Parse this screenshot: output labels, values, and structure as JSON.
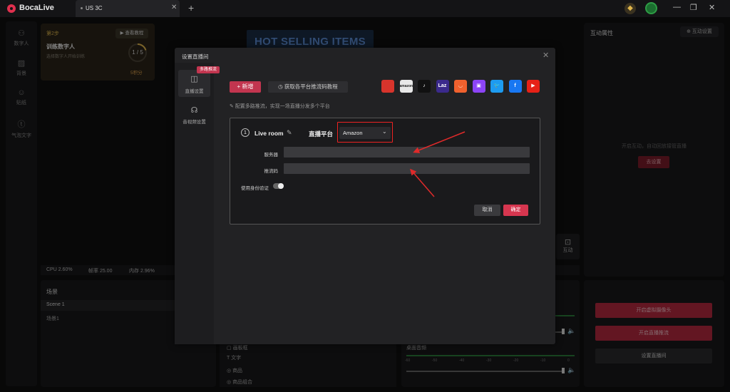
{
  "app": {
    "name": "BocaLive",
    "tab_label": "US 3C",
    "tab_close": "✕",
    "new_tab": "+"
  },
  "window_controls": {
    "minimize": "—",
    "maximize": "❐",
    "close": "✕"
  },
  "sidebar": {
    "items": [
      {
        "label": "数字人",
        "icon": "person-icon"
      },
      {
        "label": "背景",
        "icon": "stripes-icon"
      },
      {
        "label": "贴纸",
        "icon": "sticker-icon"
      },
      {
        "label": "气泡文字",
        "icon": "bubble-icon"
      }
    ]
  },
  "task": {
    "step": "第2步",
    "tutorial_label": "查看教程",
    "title": "训练数字人",
    "description": "选择数字人开始训练",
    "progress": "1 / 5",
    "progress_fraction": 0.2,
    "points": "5积分"
  },
  "preview": {
    "banner_text": "HOT SELLING ITEMS"
  },
  "right_panel": {
    "title": "互动属性",
    "settings_label": "互动设置",
    "hint": "开启互动，自动回放接管直播",
    "go_settings": "去设置"
  },
  "interact_button": "互动",
  "stats": {
    "cpu": "CPU 2.60%",
    "fps": "帧率 25.00",
    "mem": "内存 2.96%"
  },
  "scenes": {
    "title": "场景",
    "items": [
      "Scene 1",
      "场景1"
    ]
  },
  "materials": {
    "items": [
      "画板框",
      "文字",
      "商品",
      "商品组合"
    ]
  },
  "audio": {
    "desktop_label": "桌面音频",
    "scale": [
      "-60",
      "-50",
      "-40",
      "-30",
      "-20",
      "-10",
      "0"
    ]
  },
  "actions": {
    "virtual_camera": "开启虚拟摄像头",
    "start_stream": "开启直播推流",
    "setup_room": "设置直播间"
  },
  "modal": {
    "title": "设置直播间",
    "close": "✕",
    "badge": "多路推流",
    "nav": [
      {
        "label": "直播设置",
        "icon": "camera-icon"
      },
      {
        "label": "音视频设置",
        "icon": "headphones-icon"
      }
    ],
    "add_label": "+ 新增",
    "guide_label": "获取各平台推流码教程",
    "hint": "配置多路推流，实现一场直播分发多个平台",
    "platforms": [
      {
        "name": "shop",
        "label": "",
        "color": "#d8342c"
      },
      {
        "name": "amazon",
        "label": "amazon",
        "color": "#e8e8e8"
      },
      {
        "name": "tiktok",
        "label": "♪",
        "color": "#111111"
      },
      {
        "name": "lazada",
        "label": "Laz",
        "color": "#3b2a8c"
      },
      {
        "name": "aliexpress",
        "label": "◡",
        "color": "#f0612e"
      },
      {
        "name": "twitch",
        "label": "▣",
        "color": "#8c44f7"
      },
      {
        "name": "twitter",
        "label": "🐦",
        "color": "#1d9bf0"
      },
      {
        "name": "facebook",
        "label": "f",
        "color": "#1877f2"
      },
      {
        "name": "youtube",
        "label": "▶",
        "color": "#e62117"
      }
    ],
    "room": {
      "number": "1",
      "name": "Live room",
      "platform_label": "直播平台",
      "platform_value": "Amazon",
      "server_label": "服务器",
      "server_value": "",
      "key_label": "推流码",
      "key_value": "",
      "auth_label": "使用身份验证"
    },
    "cancel": "取消",
    "confirm": "确定"
  },
  "colors": {
    "accent": "#c2354f",
    "highlight": "#e22222"
  }
}
